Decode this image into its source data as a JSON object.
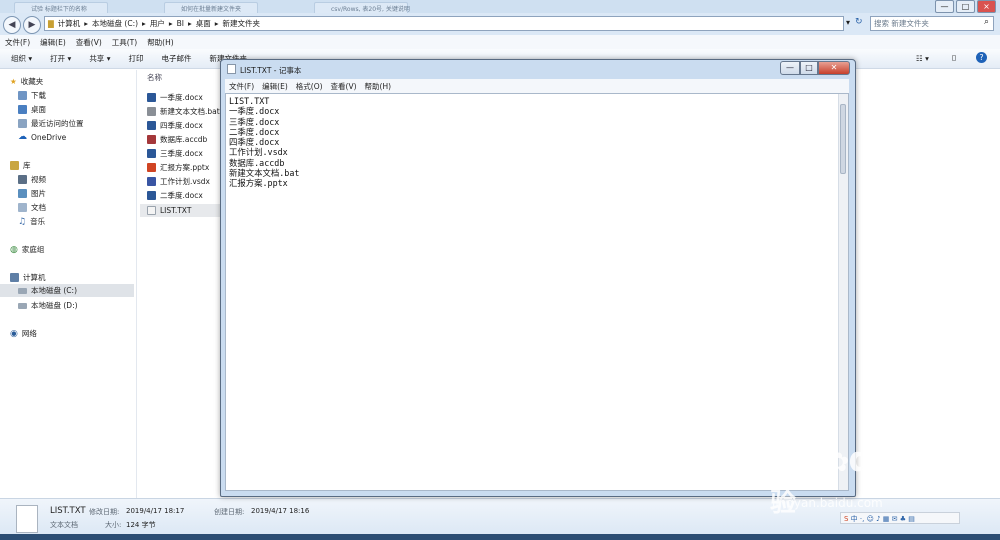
{
  "explorer": {
    "tabs": [
      "试验 标题栏下的名称",
      "如何在批量新建文件夹",
      "csv/Rows, 表20号, 关键说明"
    ],
    "window_controls": {
      "minimize": "—",
      "maximize": "□",
      "close": "×"
    },
    "breadcrumb": [
      "计算机",
      "本地磁盘 (C:)",
      "用户",
      "BI",
      "桌面",
      "新建文件夹"
    ],
    "search_placeholder": "搜索 新建文件夹",
    "menu": [
      "文件(F)",
      "编辑(E)",
      "查看(V)",
      "工具(T)",
      "帮助(H)"
    ],
    "toolbar": [
      "组织 ▾",
      "打开 ▾",
      "共享 ▾",
      "打印",
      "电子邮件",
      "新建文件夹"
    ],
    "column_header": "名称",
    "sidebar": {
      "favorites": {
        "title": "收藏夹",
        "items": [
          "下载",
          "桌面",
          "最近访问的位置",
          "OneDrive"
        ]
      },
      "libraries": {
        "title": "库",
        "items": [
          "视频",
          "图片",
          "文档",
          "音乐"
        ]
      },
      "homegroup": "家庭组",
      "computer": {
        "title": "计算机",
        "items": [
          "本地磁盘 (C:)",
          "本地磁盘 (D:)"
        ]
      },
      "network": "网络"
    },
    "files": [
      "一季度.docx",
      "新建文本文档.bat",
      "四季度.docx",
      "数据库.accdb",
      "三季度.docx",
      "汇报方案.pptx",
      "工作计划.vsdx",
      "二季度.docx",
      "LIST.TXT"
    ],
    "status": {
      "file_name": "LIST.TXT",
      "modified_label": "修改日期:",
      "modified_value": "2019/4/17 18:17",
      "created_label": "创建日期:",
      "created_value": "2019/4/17 18:16",
      "type": "文本文档",
      "size_label": "大小:",
      "size_value": "124 字节"
    }
  },
  "notepad": {
    "title": "LIST.TXT - 记事本",
    "menu": [
      "文件(F)",
      "编辑(E)",
      "格式(O)",
      "查看(V)",
      "帮助(H)"
    ],
    "lines": [
      "LIST.TXT",
      "一季度.docx",
      "三季度.docx",
      "二季度.docx",
      "四季度.docx",
      "工作计划.vsdx",
      "数据库.accdb",
      "新建文本文档.bat",
      "汇报方案.pptx"
    ]
  },
  "watermark": {
    "brand": "Bai",
    "brand2": "du",
    "cn": "经验",
    "url": "jingyan.baidu.com"
  },
  "colors": {
    "accent": "#1e62b8",
    "word": "#2b5797",
    "access": "#a4373a",
    "ppt": "#d04423",
    "visio": "#3955a3"
  }
}
